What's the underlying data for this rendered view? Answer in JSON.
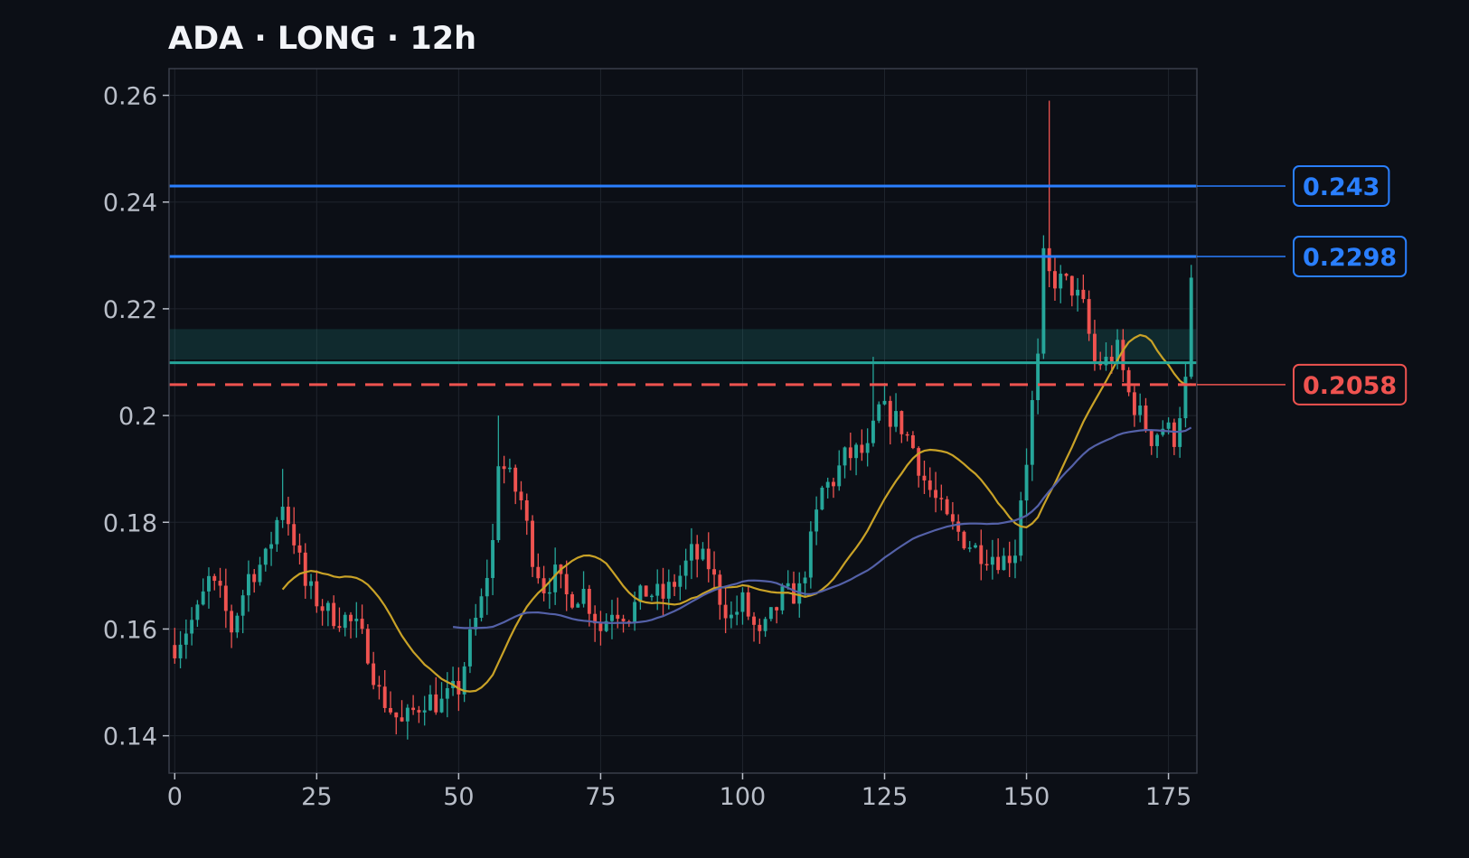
{
  "title": "ADA · LONG · 12h",
  "colors": {
    "background": "#0c0f16",
    "plot_border": "#3a3f4a",
    "grid": "#1f242d",
    "up": "#26a69a",
    "down": "#ef5350",
    "ma_fast": "#c9a227",
    "ma_slow": "#5461a8",
    "target": "#2a7fff",
    "entry": "#26a69a",
    "stop": "#ef5350"
  },
  "chart_data": {
    "type": "candlestick",
    "title": "ADA · LONG · 12h",
    "xlim": [
      -1,
      180
    ],
    "ylim": [
      0.133,
      0.265
    ],
    "x_ticks": [
      0,
      25,
      50,
      75,
      100,
      125,
      150,
      175
    ],
    "y_ticks": [
      0.14,
      0.16,
      0.18,
      0.2,
      0.22,
      0.24,
      0.26
    ],
    "y_tick_labels": [
      "0.14",
      "0.16",
      "0.18",
      "0.2",
      "0.22",
      "0.24",
      "0.26"
    ],
    "grid": true,
    "anchors": [
      [
        0,
        0.157
      ],
      [
        4,
        0.163
      ],
      [
        6,
        0.169
      ],
      [
        8,
        0.166
      ],
      [
        10,
        0.16
      ],
      [
        13,
        0.17
      ],
      [
        16,
        0.173
      ],
      [
        19,
        0.184
      ],
      [
        21,
        0.177
      ],
      [
        23,
        0.168
      ],
      [
        27,
        0.163
      ],
      [
        30,
        0.162
      ],
      [
        32,
        0.16
      ],
      [
        34,
        0.156
      ],
      [
        36,
        0.148
      ],
      [
        38,
        0.145
      ],
      [
        40,
        0.142
      ],
      [
        44,
        0.147
      ],
      [
        47,
        0.146
      ],
      [
        50,
        0.149
      ],
      [
        52,
        0.158
      ],
      [
        54,
        0.165
      ],
      [
        56,
        0.176
      ],
      [
        57,
        0.192
      ],
      [
        59,
        0.188
      ],
      [
        61,
        0.184
      ],
      [
        63,
        0.174
      ],
      [
        65,
        0.168
      ],
      [
        67,
        0.17
      ],
      [
        69,
        0.166
      ],
      [
        72,
        0.167
      ],
      [
        75,
        0.16
      ],
      [
        77,
        0.164
      ],
      [
        80,
        0.163
      ],
      [
        83,
        0.167
      ],
      [
        86,
        0.166
      ],
      [
        89,
        0.17
      ],
      [
        91,
        0.174
      ],
      [
        94,
        0.172
      ],
      [
        96,
        0.166
      ],
      [
        98,
        0.162
      ],
      [
        100,
        0.165
      ],
      [
        103,
        0.158
      ],
      [
        105,
        0.162
      ],
      [
        107,
        0.166
      ],
      [
        110,
        0.167
      ],
      [
        112,
        0.176
      ],
      [
        114,
        0.186
      ],
      [
        116,
        0.188
      ],
      [
        118,
        0.192
      ],
      [
        120,
        0.193
      ],
      [
        122,
        0.193
      ],
      [
        124,
        0.201
      ],
      [
        126,
        0.2
      ],
      [
        128,
        0.198
      ],
      [
        130,
        0.194
      ],
      [
        132,
        0.188
      ],
      [
        134,
        0.184
      ],
      [
        136,
        0.18
      ],
      [
        138,
        0.178
      ],
      [
        141,
        0.175
      ],
      [
        144,
        0.174
      ],
      [
        146,
        0.173
      ],
      [
        148,
        0.175
      ],
      [
        149,
        0.185
      ],
      [
        150,
        0.192
      ],
      [
        151,
        0.202
      ],
      [
        152,
        0.21
      ],
      [
        153,
        0.229
      ],
      [
        154,
        0.226
      ],
      [
        156,
        0.225
      ],
      [
        158,
        0.224
      ],
      [
        160,
        0.22
      ],
      [
        162,
        0.21
      ],
      [
        164,
        0.21
      ],
      [
        166,
        0.212
      ],
      [
        168,
        0.204
      ],
      [
        170,
        0.2
      ],
      [
        172,
        0.196
      ],
      [
        174,
        0.198
      ],
      [
        176,
        0.196
      ],
      [
        178,
        0.206
      ],
      [
        179,
        0.224
      ]
    ],
    "wick_spikes": [
      [
        154,
        0.259
      ],
      [
        123,
        0.211
      ],
      [
        57,
        0.2
      ],
      [
        19,
        0.19
      ]
    ],
    "levels": [
      {
        "name": "target-2",
        "value": 0.243,
        "label": "0.243",
        "style": "solid",
        "tag": true
      },
      {
        "name": "target-1",
        "value": 0.2298,
        "label": "0.2298",
        "style": "solid",
        "tag": true
      },
      {
        "name": "entry",
        "value": 0.2099,
        "style": "solid",
        "tag": false
      },
      {
        "name": "stop",
        "value": 0.2058,
        "label": "0.2058",
        "style": "dashed",
        "tag": true
      }
    ],
    "entry_zone": [
      0.2105,
      0.2162
    ],
    "moving_averages": [
      {
        "name": "ma-fast",
        "period": 20,
        "color": "#c9a227"
      },
      {
        "name": "ma-slow",
        "period": 50,
        "color": "#5461a8"
      }
    ]
  }
}
